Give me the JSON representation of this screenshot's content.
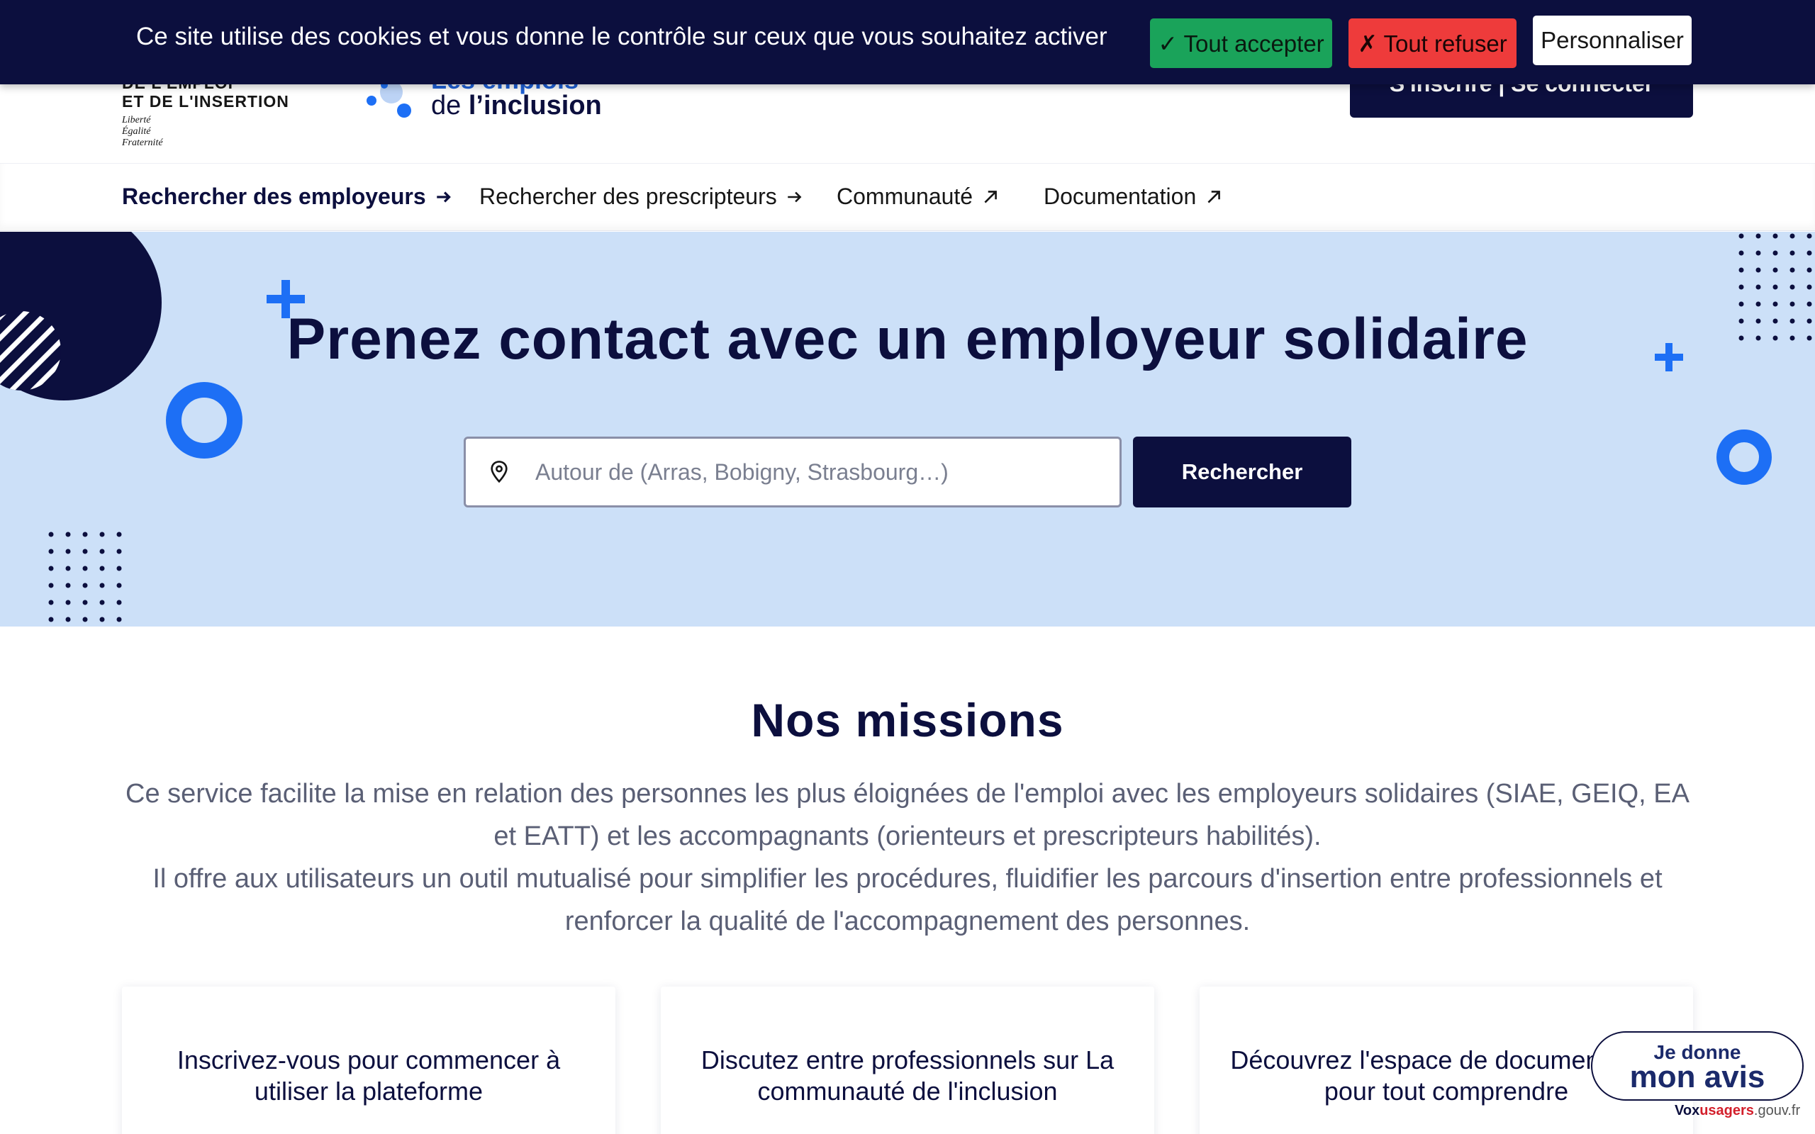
{
  "cookie_banner": {
    "message": "Ce site utilise des cookies et vous donne le contrôle sur ceux que vous souhaitez activer",
    "accept_label": "✓ Tout accepter",
    "refuse_label": "✗ Tout refuser",
    "customize_label": "Personnaliser"
  },
  "header": {
    "gov_line1": "DE L'EMPLOI",
    "gov_line2": "ET DE L'INSERTION",
    "gov_motto": [
      "Liberté",
      "Égalité",
      "Fraternité"
    ],
    "site_logo_top": "Les emplois",
    "site_logo_prefix": "de",
    "site_logo_main": "l’inclusion",
    "login_label": "S'inscrire | Se connecter"
  },
  "nav": {
    "items": [
      {
        "label": "Rechercher des employeurs",
        "icon": "arrow-right-icon"
      },
      {
        "label": "Rechercher des prescripteurs",
        "icon": "arrow-right-icon"
      },
      {
        "label": "Communauté",
        "icon": "external-link-icon"
      },
      {
        "label": "Documentation",
        "icon": "external-link-icon"
      }
    ]
  },
  "hero": {
    "title": "Prenez contact avec un employeur solidaire",
    "search_placeholder": "Autour de (Arras, Bobigny, Strasbourg…)",
    "search_button": "Rechercher"
  },
  "missions": {
    "title": "Nos missions",
    "paragraph1": "Ce service facilite la mise en relation des personnes les plus éloignées de l'emploi avec les employeurs solidaires (SIAE, GEIQ, EA et EATT) et les accompagnants (orienteurs et prescripteurs habilités).",
    "paragraph2": "Il offre aux utilisateurs un outil mutualisé pour simplifier les procédures, fluidifier les parcours d'insertion entre professionnels et renforcer la qualité de l'accompagnement des personnes.",
    "cards": [
      {
        "text": "Inscrivez-vous pour commencer à utiliser la plateforme"
      },
      {
        "text": "Discutez entre professionnels sur La communauté de l'inclusion"
      },
      {
        "text": "Découvrez l'espace de documentation pour tout comprendre"
      }
    ]
  },
  "vox": {
    "small": "Je donne",
    "big": "mon avis",
    "brand_prefix": "Vox",
    "brand_mid": "usagers",
    "brand_suffix": ".gouv.fr"
  },
  "colors": {
    "navy": "#0c0f3e",
    "hero_bg": "#cce0f8",
    "accent_blue": "#1d6ff5",
    "accept_green": "#1aa35a",
    "refuse_red": "#ee3b3b"
  }
}
